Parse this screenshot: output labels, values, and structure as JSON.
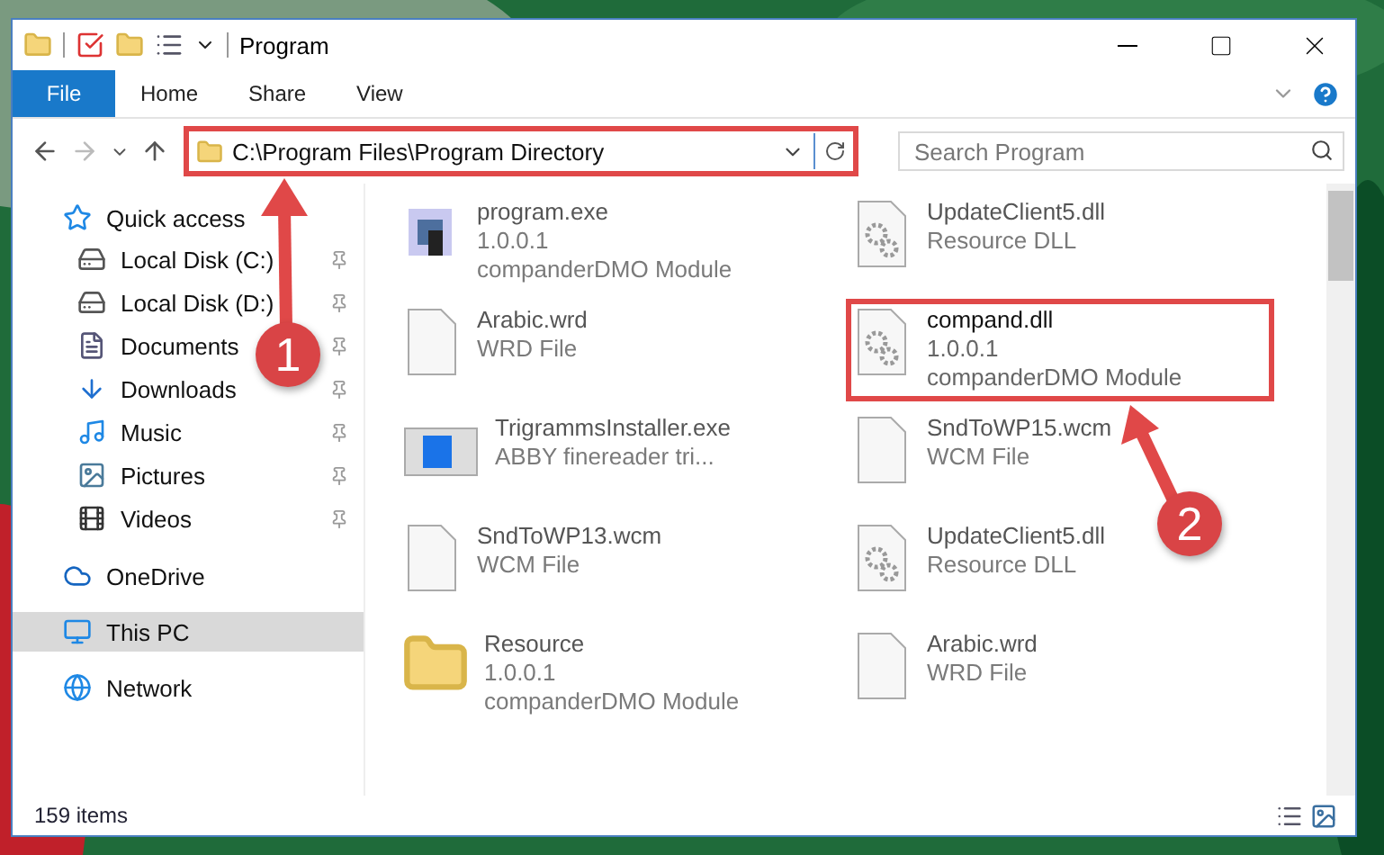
{
  "window": {
    "title": "Program"
  },
  "ribbon_tabs": [
    {
      "label": "File",
      "kind": "file"
    },
    {
      "label": "Home",
      "kind": "tab"
    },
    {
      "label": "Share",
      "kind": "tab"
    },
    {
      "label": "View",
      "kind": "tab"
    }
  ],
  "address": {
    "path": "C:\\Program Files\\Program Directory",
    "highlighted": true
  },
  "search": {
    "placeholder": "Search Program"
  },
  "sidebar": {
    "items": [
      {
        "label": "Quick access",
        "kind": "star",
        "selected": false,
        "children": [
          {
            "label": "Local Disk (C:)",
            "kind": "drive",
            "pinned": true
          },
          {
            "label": "Local Disk (D:)",
            "kind": "drive",
            "pinned": true
          },
          {
            "label": "Documents",
            "kind": "documents",
            "pinned": true
          },
          {
            "label": "Downloads",
            "kind": "downloads",
            "pinned": true
          },
          {
            "label": "Music",
            "kind": "music",
            "pinned": true
          },
          {
            "label": "Pictures",
            "kind": "pictures",
            "pinned": true
          },
          {
            "label": "Videos",
            "kind": "videos",
            "pinned": true
          }
        ]
      },
      {
        "label": "OneDrive",
        "kind": "cloud",
        "selected": false
      },
      {
        "label": "This PC",
        "kind": "pc",
        "selected": true
      },
      {
        "label": "Network",
        "kind": "network",
        "selected": false
      }
    ]
  },
  "files": [
    {
      "name": "program.exe",
      "details": [
        "1.0.0.1",
        "companderDMO Module"
      ],
      "kind": "exe",
      "faded": true,
      "highlighted": false
    },
    {
      "name": "UpdateClient5.dll",
      "details": [
        "Resource DLL"
      ],
      "kind": "dll",
      "faded": true,
      "highlighted": false
    },
    {
      "name": "Arabic.wrd",
      "details": [
        "WRD File"
      ],
      "kind": "doc",
      "faded": true,
      "highlighted": false
    },
    {
      "name": "compand.dll",
      "details": [
        "1.0.0.1",
        "companderDMO Module"
      ],
      "kind": "dll",
      "faded": false,
      "highlighted": true
    },
    {
      "name": "TrigrammsInstaller.exe",
      "details": [
        "ABBY finereader tri..."
      ],
      "kind": "installer",
      "faded": true,
      "highlighted": false
    },
    {
      "name": "SndToWP15.wcm",
      "details": [
        "WCM File"
      ],
      "kind": "doc",
      "faded": true,
      "highlighted": false
    },
    {
      "name": "SndToWP13.wcm",
      "details": [
        "WCM File"
      ],
      "kind": "doc",
      "faded": true,
      "highlighted": false
    },
    {
      "name": "UpdateClient5.dll",
      "details": [
        "Resource DLL"
      ],
      "kind": "dll",
      "faded": true,
      "highlighted": false
    },
    {
      "name": "Resource",
      "details": [
        "1.0.0.1",
        "companderDMO Module"
      ],
      "kind": "folder",
      "faded": true,
      "highlighted": false
    },
    {
      "name": "Arabic.wrd",
      "details": [
        "WRD File"
      ],
      "kind": "doc",
      "faded": true,
      "highlighted": false
    }
  ],
  "status_bar": {
    "count": "159 items"
  },
  "callouts": [
    {
      "number": "1"
    },
    {
      "number": "2"
    }
  ]
}
